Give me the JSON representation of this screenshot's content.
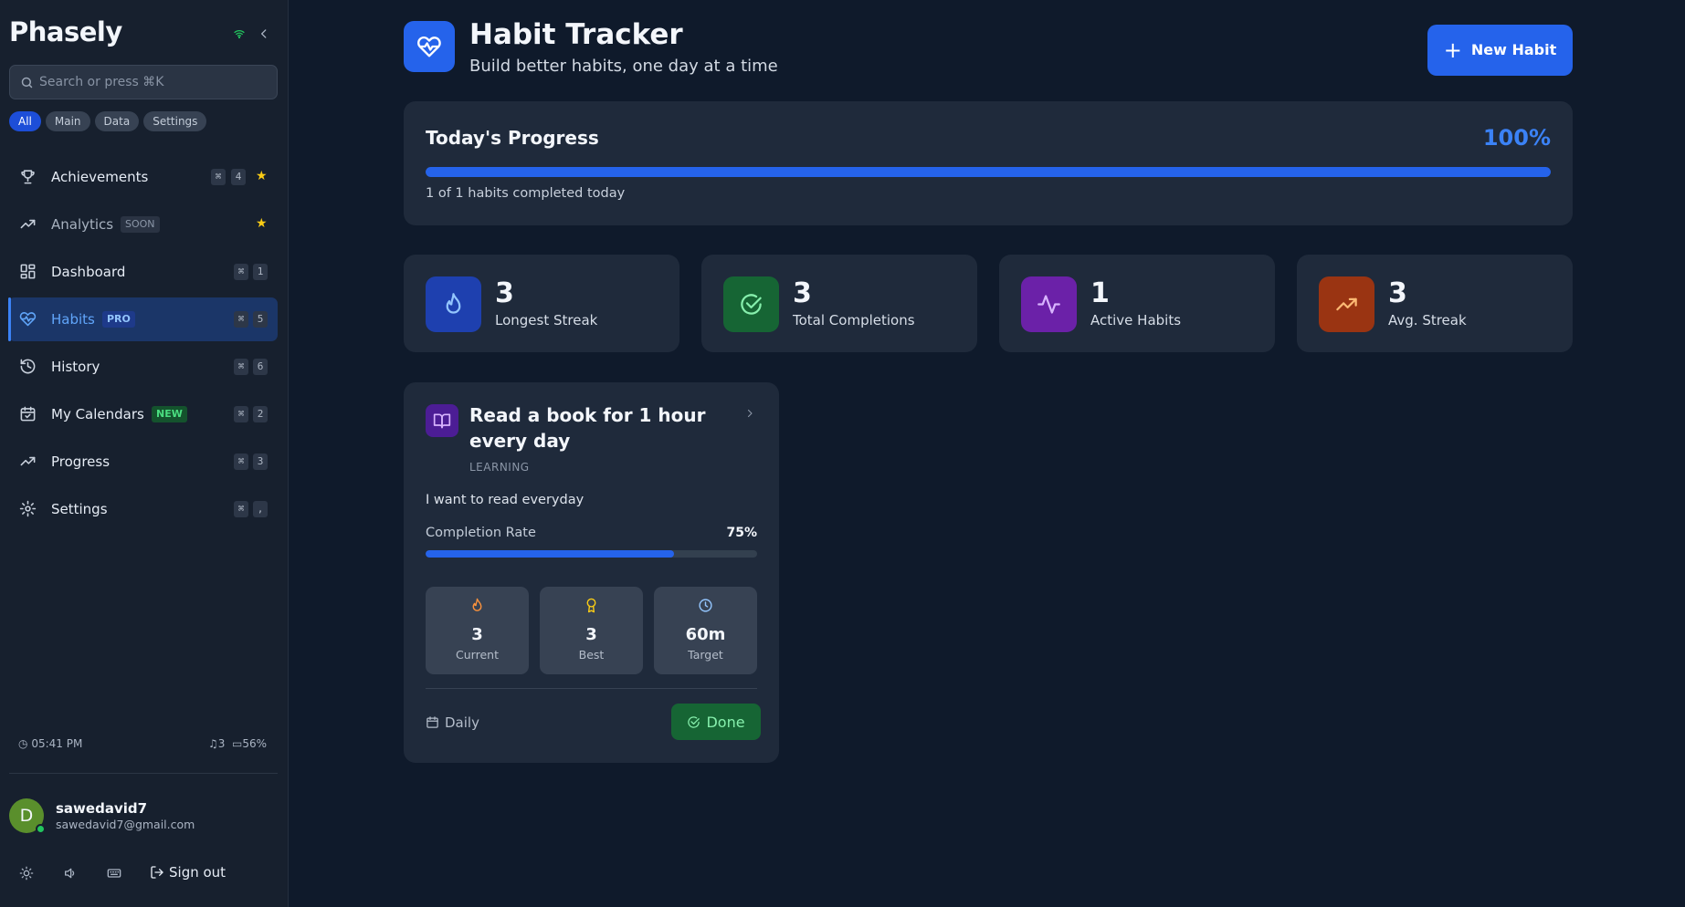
{
  "sidebar": {
    "logo": "Phasely",
    "search_placeholder": "Search or press ⌘K",
    "filters": [
      "All",
      "Main",
      "Data",
      "Settings"
    ],
    "items": [
      {
        "label": "Achievements",
        "badge": "",
        "key": "4",
        "starred": true
      },
      {
        "label": "Analytics",
        "badge": "SOON",
        "key": "",
        "starred": true
      },
      {
        "label": "Dashboard",
        "badge": "",
        "key": "1",
        "starred": false
      },
      {
        "label": "Habits",
        "badge": "PRO",
        "key": "5",
        "starred": false,
        "active": true
      },
      {
        "label": "History",
        "badge": "",
        "key": "6",
        "starred": false
      },
      {
        "label": "My Calendars",
        "badge": "NEW",
        "key": "2",
        "starred": false
      },
      {
        "label": "Progress",
        "badge": "",
        "key": "3",
        "starred": false
      },
      {
        "label": "Settings",
        "badge": "",
        "key": ",",
        "starred": false
      }
    ],
    "cmd_symbol": "⌘",
    "status": {
      "time": "05:41 PM",
      "notifications": "3",
      "battery": "56%"
    },
    "user": {
      "initial": "D",
      "name": "sawedavid7",
      "email": "sawedavid7@gmail.com"
    },
    "sign_out_label": "Sign out"
  },
  "header": {
    "title": "Habit Tracker",
    "subtitle": "Build better habits, one day at a time",
    "new_habit_label": "New Habit"
  },
  "progress": {
    "title": "Today's Progress",
    "percent_label": "100%",
    "percent": 100,
    "summary": "1 of 1 habits completed today"
  },
  "stats": [
    {
      "value": "3",
      "label": "Longest Streak",
      "icon": "flame-icon",
      "color": "#1e40af",
      "fg": "#93c5fd"
    },
    {
      "value": "3",
      "label": "Total Completions",
      "icon": "check-circle-icon",
      "color": "#166534",
      "fg": "#86efac"
    },
    {
      "value": "1",
      "label": "Active Habits",
      "icon": "activity-icon",
      "color": "#6b21a8",
      "fg": "#d8b4fe"
    },
    {
      "value": "3",
      "label": "Avg. Streak",
      "icon": "trending-up-icon",
      "color": "#9a3412",
      "fg": "#fdba74"
    }
  ],
  "habit": {
    "title": "Read a book for 1 hour every day",
    "category": "LEARNING",
    "description": "I want to read everyday",
    "rate_label": "Completion Rate",
    "rate_value_label": "75%",
    "rate": 75,
    "metrics": [
      {
        "value": "3",
        "label": "Current",
        "icon": "flame-icon",
        "color": "#fb923c"
      },
      {
        "value": "3",
        "label": "Best",
        "icon": "award-icon",
        "color": "#facc15"
      },
      {
        "value": "60m",
        "label": "Target",
        "icon": "clock-icon",
        "color": "#93c5fd"
      }
    ],
    "frequency": "Daily",
    "done_label": "Done"
  }
}
